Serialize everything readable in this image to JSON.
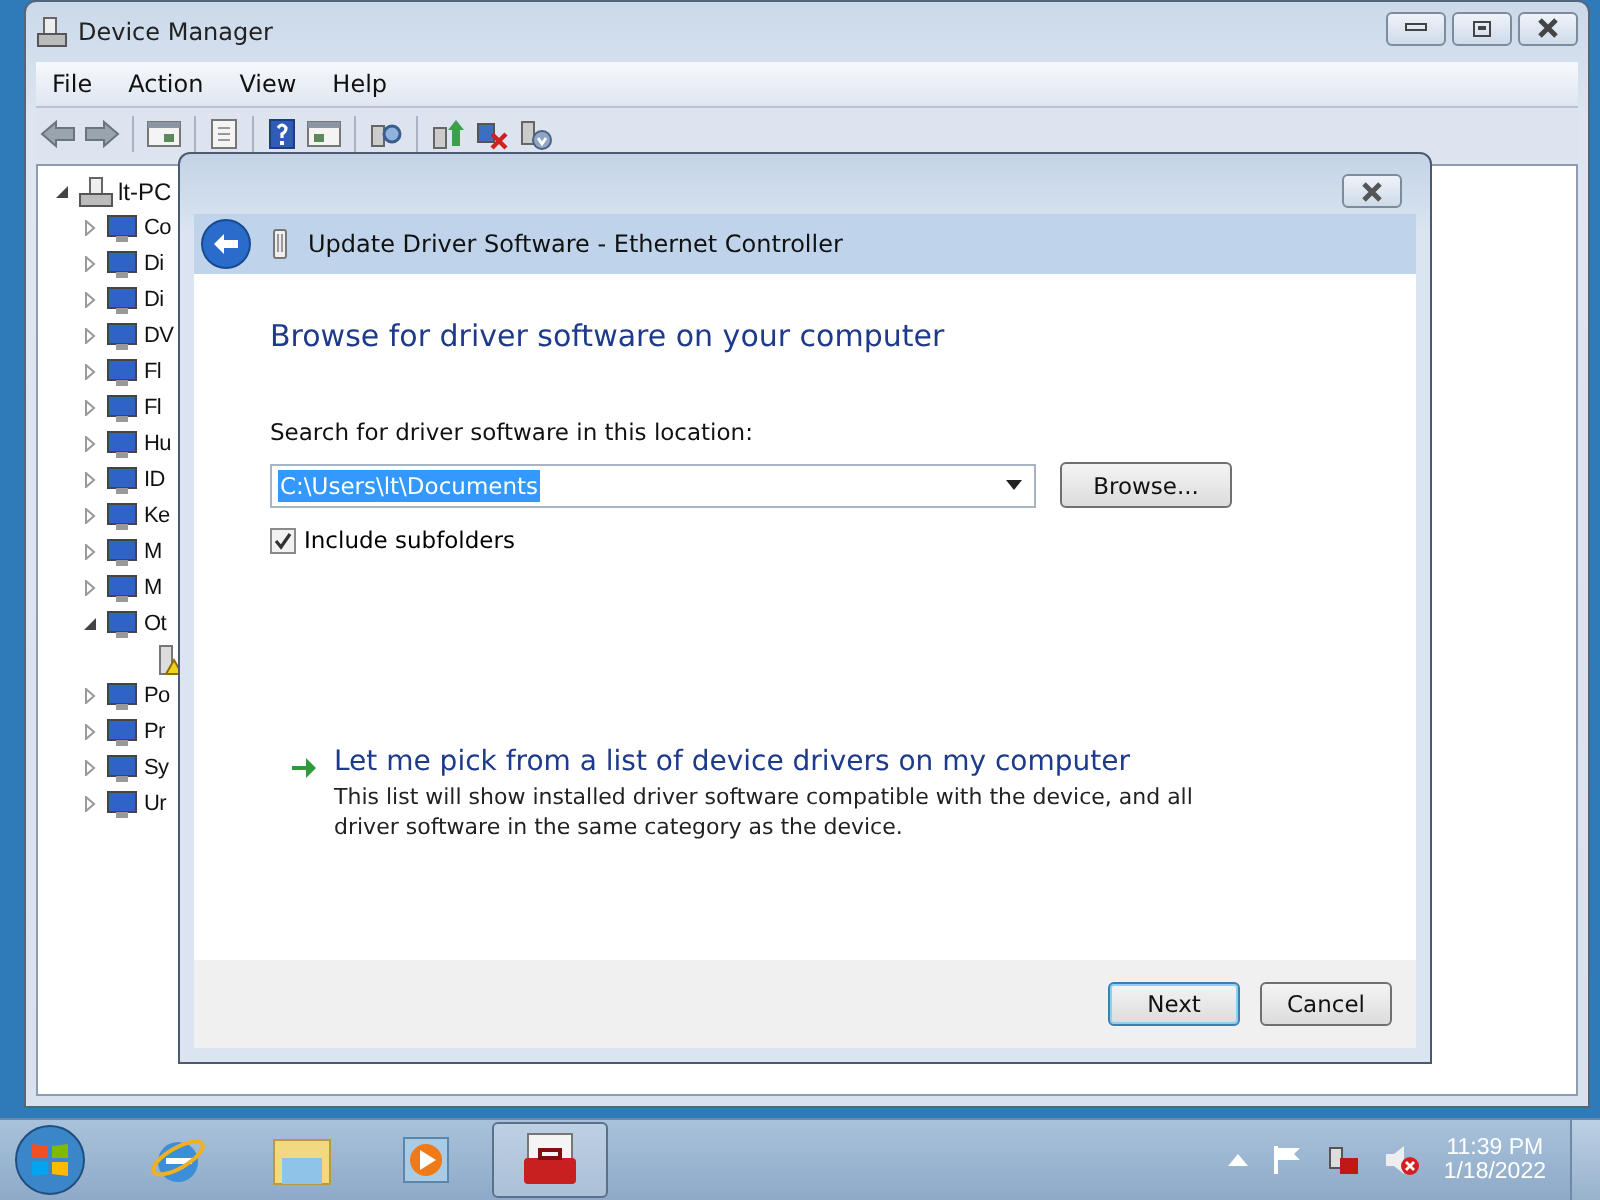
{
  "window": {
    "title": "Device Manager"
  },
  "menu": [
    "File",
    "Action",
    "View",
    "Help"
  ],
  "tree": {
    "label": "lt-PC",
    "expanded": true,
    "children": [
      {
        "label": "Co",
        "expanded": false
      },
      {
        "label": "Di",
        "expanded": false
      },
      {
        "label": "Di",
        "expanded": false
      },
      {
        "label": "DV",
        "expanded": false
      },
      {
        "label": "Fl",
        "expanded": false
      },
      {
        "label": "Fl",
        "expanded": false
      },
      {
        "label": "Hu",
        "expanded": false
      },
      {
        "label": "ID",
        "expanded": false
      },
      {
        "label": "Ke",
        "expanded": false
      },
      {
        "label": "M",
        "expanded": false
      },
      {
        "label": "M",
        "expanded": false
      },
      {
        "label": "Ot",
        "expanded": true,
        "children": [
          {
            "warning": true
          }
        ]
      },
      {
        "label": "Po",
        "expanded": false
      },
      {
        "label": "Pr",
        "expanded": false
      },
      {
        "label": "Sy",
        "expanded": false
      },
      {
        "label": "Ur",
        "expanded": false
      }
    ]
  },
  "dialog": {
    "title": "Update Driver Software - Ethernet Controller",
    "heading": "Browse for driver software on your computer",
    "location_label": "Search for driver software in this location:",
    "location": {
      "value": "C:\\Users\\lt\\Documents",
      "selected": true
    },
    "browse_button": "Browse...",
    "include_subfolders": {
      "label": "Include subfolders",
      "checked": true
    },
    "pick_link": {
      "label": "Let me pick from a list of device drivers on my computer",
      "description": "This list will show installed driver software compatible with the device, and all driver software in the same category as the device."
    },
    "buttons": [
      {
        "label": "Next",
        "default": true
      },
      {
        "label": "Cancel",
        "default": false
      }
    ]
  },
  "taskbar": {
    "apps": [
      {
        "kind": "browser",
        "active": false
      },
      {
        "kind": "folder",
        "active": false
      },
      {
        "kind": "media",
        "active": false
      },
      {
        "kind": "toolbox",
        "active": true
      }
    ],
    "clock": {
      "time": "11:39 PM",
      "date": "1/18/2022"
    }
  }
}
